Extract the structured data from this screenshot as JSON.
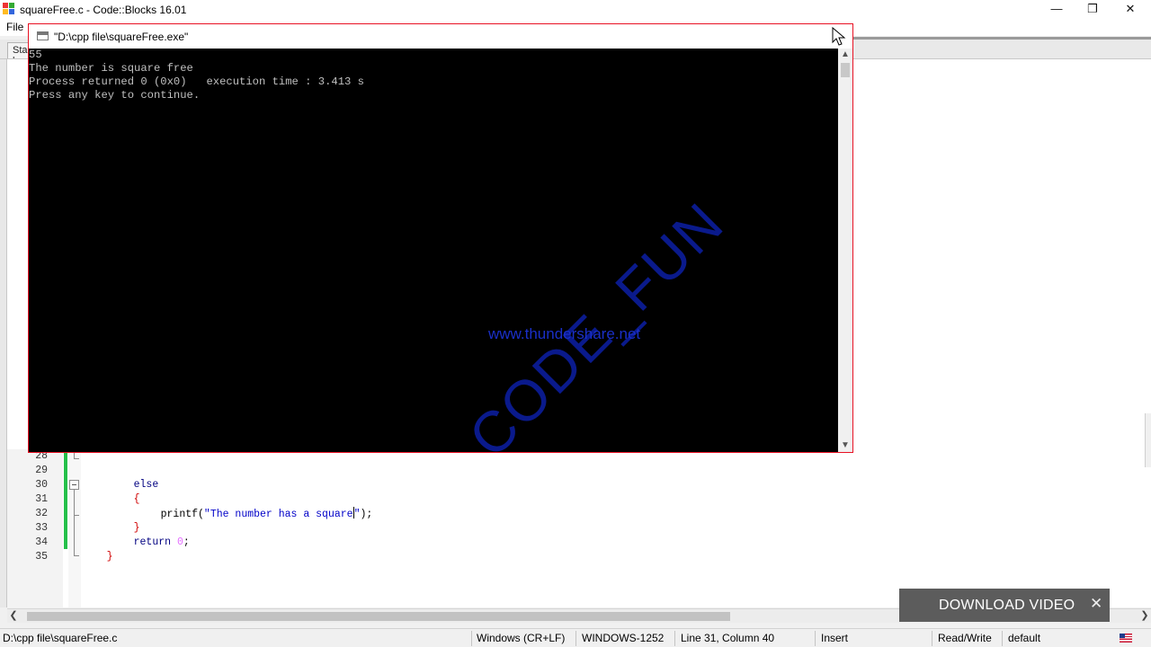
{
  "ide": {
    "title": "squareFree.c - Code::Blocks 16.01",
    "menu_file": "File",
    "tab_start_label": "Start here",
    "controls": {
      "minimize": "—",
      "restore": "❐",
      "close": "✕"
    }
  },
  "console": {
    "title": "\"D:\\cpp file\\squareFree.exe\"",
    "lines": [
      "55",
      "The number is square free",
      "Process returned 0 (0x0)   execution time : 3.413 s",
      "Press any key to continue."
    ]
  },
  "watermark": {
    "url": "www.thundershare.net",
    "brand": "CODE_FUN"
  },
  "code": {
    "line_numbers": [
      "28",
      "29",
      "30",
      "31",
      "32",
      "33",
      "34",
      "35"
    ],
    "lines": [
      {
        "kw": "else"
      },
      {
        "brace": "{"
      },
      {
        "pre": "printf(",
        "str": "\"The number has a square",
        "str_after": "\"",
        "post": ");"
      },
      {
        "brace": "}"
      },
      {
        "kw": "return",
        "num": "0",
        "post": ";"
      },
      {
        "brace": "}"
      }
    ]
  },
  "status": {
    "file_path": "D:\\cpp file\\squareFree.c",
    "line_endings": "Windows (CR+LF)",
    "encoding": "WINDOWS-1252",
    "position": "Line 31, Column 40",
    "mode": "Insert",
    "access": "Read/Write",
    "profile": "default"
  },
  "download": {
    "label": "DOWNLOAD VIDEO",
    "close": "✕"
  },
  "colors": {
    "console_bg": "#000000",
    "console_text": "#c0c0c0",
    "keyword": "#000080",
    "string": "#0000c8",
    "number": "#e36cff",
    "brace": "#d00000",
    "change_bar": "#25c04a",
    "console_border": "#e81123"
  }
}
